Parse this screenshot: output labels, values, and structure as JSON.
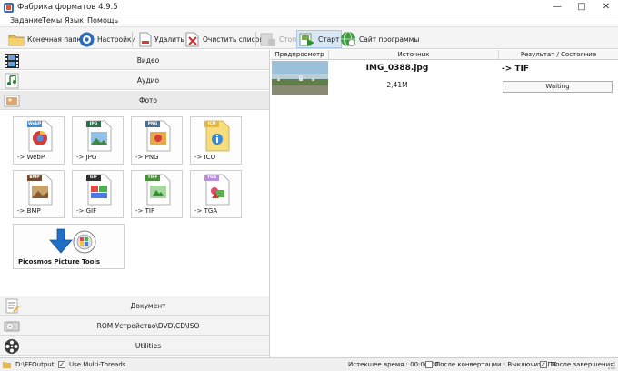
{
  "window": {
    "title": "Фабрика форматов 4.9.5",
    "controls": {
      "minimize": "—",
      "maximize": "□",
      "close": "✕"
    }
  },
  "menu": [
    "Задание",
    "Темы",
    "Язык",
    "Помощь"
  ],
  "toolbar": {
    "output_folder": "Конечная папка",
    "settings": "Настройки",
    "delete": "Удалить",
    "clear_list": "Очистить список",
    "stop": "Стоп",
    "start": "Старт",
    "website": "Сайт программы"
  },
  "categories": {
    "video": "Видео",
    "audio": "Аудио",
    "photo": "Фото",
    "document": "Документ",
    "rom": "ROM Устройство\\DVD\\CD\\ISO",
    "utilities": "Utilities"
  },
  "photo_formats": [
    {
      "label": "-> WebP",
      "tag": "WebP",
      "icon": "webp-file-icon",
      "color": "#3b8ad9"
    },
    {
      "label": "-> JPG",
      "tag": "JPG",
      "icon": "jpg-file-icon",
      "color": "#2f6f4e"
    },
    {
      "label": "-> PNG",
      "tag": "PNG",
      "icon": "png-file-icon",
      "color": "#4a6f8f"
    },
    {
      "label": "-> ICO",
      "tag": "ICO",
      "icon": "ico-file-icon",
      "color": "#e6b93a"
    },
    {
      "label": "-> BMP",
      "tag": "BMP",
      "icon": "bmp-file-icon",
      "color": "#6f4a2f"
    },
    {
      "label": "-> GIF",
      "tag": "GIF",
      "icon": "gif-file-icon",
      "color": "#2f2f2f"
    },
    {
      "label": "-> TIF",
      "tag": "TIFF",
      "icon": "tif-file-icon",
      "color": "#4a8f3a"
    },
    {
      "label": "-> TGA",
      "tag": "TGA",
      "icon": "tga-file-icon",
      "color": "#b58fd8"
    }
  ],
  "picosmos": {
    "label": "Picosmos Picture Tools"
  },
  "file_list": {
    "headers": {
      "preview": "Предпросмотр",
      "source": "Источник",
      "result": "Результат / Состояние"
    },
    "rows": [
      {
        "name": "IMG_0388.jpg",
        "size": "2,41M",
        "target": "-> TIF",
        "status": "Waiting"
      }
    ]
  },
  "statusbar": {
    "output_path": "D:\\FFOutput",
    "multithreads_label": "Use Multi-Threads",
    "multithreads_checked": true,
    "elapsed": "Истекшее время : 00:00:00",
    "after_convert_label": "После конвертации : Выключить ПК",
    "after_convert_checked": false,
    "after_finish_label": "После завершения",
    "after_finish_checked": true
  }
}
